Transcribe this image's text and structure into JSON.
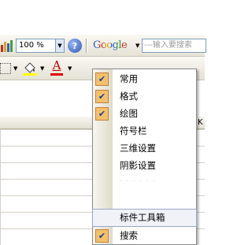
{
  "toolbar_standard": {
    "zoom_value": "100 %",
    "help_symbol": "?"
  },
  "google_bar": {
    "logo_text": "Google",
    "search_placeholder": "---输入要搜索"
  },
  "toolbar_format": {
    "font_color_glyph": "A"
  },
  "sheet": {
    "visible_column_label": "K"
  },
  "context_menu": {
    "items": [
      {
        "label": "常用",
        "checked": true
      },
      {
        "label": "格式",
        "checked": true
      },
      {
        "label": "绘图",
        "checked": true
      },
      {
        "label": "符号栏",
        "checked": false
      },
      {
        "label": "三维设置",
        "checked": false
      },
      {
        "label": "阴影设置",
        "checked": false
      },
      {
        "label": "标件工具箱",
        "checked": false
      },
      {
        "label": "搜索",
        "checked": true
      }
    ],
    "check_glyph": "✔",
    "hovered_item": "标件工具箱"
  },
  "colors": {
    "check_bg": "#f5c06c",
    "check_mark": "#173e9c",
    "font_color_bar": "#e00000"
  }
}
